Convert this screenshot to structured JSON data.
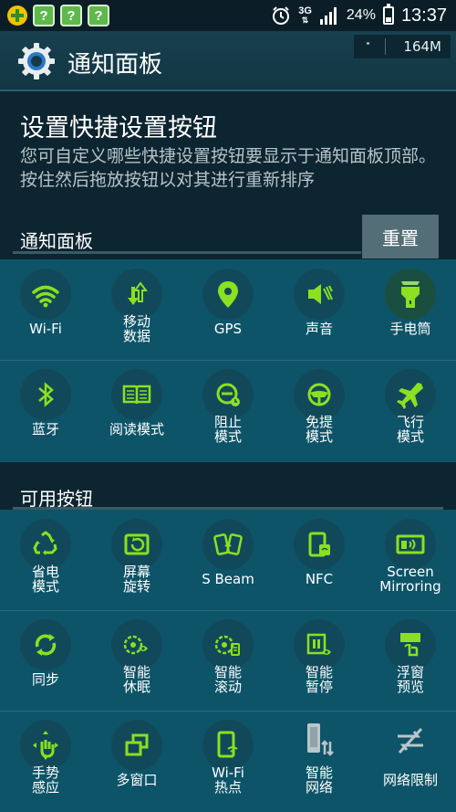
{
  "status_bar": {
    "network": "3G",
    "battery": "24%",
    "time": "13:37",
    "notification_icons": [
      "app-plus-icon",
      "question-app-icon",
      "question-app-icon",
      "question-app-icon"
    ]
  },
  "action_bar": {
    "title": "通知面板",
    "memory": "164M"
  },
  "header": {
    "title": "设置快捷设置按钮",
    "description": "您可自定义哪些快捷设置按钮要显示于通知面板顶部。按住然后拖放按钮以对其进行重新排序"
  },
  "notification_panel": {
    "label": "通知面板",
    "reset_label": "重置",
    "buttons": [
      {
        "label": "Wi-Fi",
        "icon": "wifi-icon"
      },
      {
        "label": "移动\n数据",
        "icon": "mobile-data-icon"
      },
      {
        "label": "GPS",
        "icon": "gps-icon"
      },
      {
        "label": "声音",
        "icon": "sound-icon"
      },
      {
        "label": "手电筒",
        "icon": "flashlight-icon"
      },
      {
        "label": "蓝牙",
        "icon": "bluetooth-icon"
      },
      {
        "label": "阅读模式",
        "icon": "reading-mode-icon"
      },
      {
        "label": "阻止\n模式",
        "icon": "blocking-mode-icon"
      },
      {
        "label": "免提\n模式",
        "icon": "driving-mode-icon"
      },
      {
        "label": "飞行\n模式",
        "icon": "airplane-mode-icon"
      }
    ]
  },
  "available_buttons": {
    "label": "可用按钮",
    "buttons": [
      {
        "label": "省电\n模式",
        "icon": "power-saving-icon"
      },
      {
        "label": "屏幕\n旋转",
        "icon": "screen-rotation-icon"
      },
      {
        "label": "S Beam",
        "icon": "s-beam-icon"
      },
      {
        "label": "NFC",
        "icon": "nfc-icon"
      },
      {
        "label": "Screen\nMirroring",
        "icon": "screen-mirroring-icon"
      },
      {
        "label": "同步",
        "icon": "sync-icon"
      },
      {
        "label": "智能\n休眠",
        "icon": "smart-stay-icon"
      },
      {
        "label": "智能\n滚动",
        "icon": "smart-scroll-icon"
      },
      {
        "label": "智能\n暂停",
        "icon": "smart-pause-icon"
      },
      {
        "label": "浮窗\n预览",
        "icon": "air-view-icon"
      },
      {
        "label": "手势\n感应",
        "icon": "air-gesture-icon"
      },
      {
        "label": "多窗口",
        "icon": "multi-window-icon"
      },
      {
        "label": "Wi-Fi\n热点",
        "icon": "wifi-hotspot-icon"
      },
      {
        "label": "智能\n网络",
        "icon": "smart-network-icon"
      },
      {
        "label": "网络限制",
        "icon": "network-restriction-icon"
      }
    ]
  },
  "colors": {
    "accent_green": "#8be01f",
    "panel_teal": "#0e5468",
    "header_dark": "#0d2530"
  }
}
